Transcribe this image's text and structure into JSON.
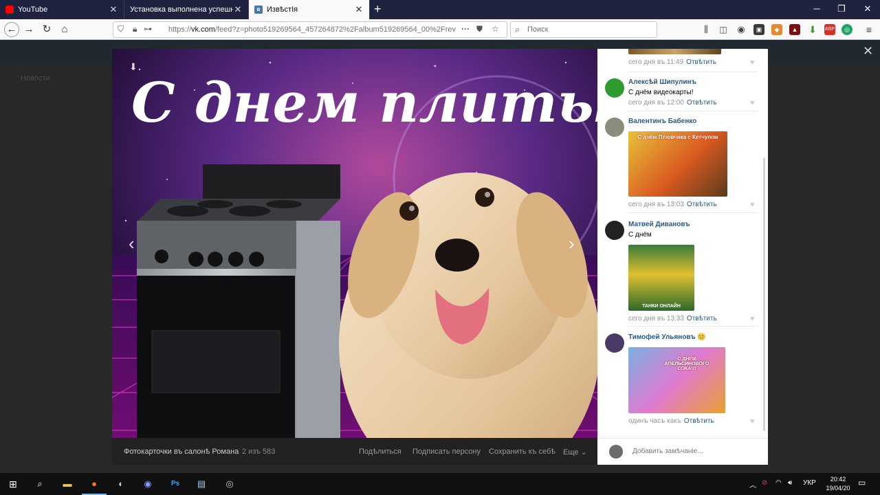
{
  "tabs": [
    {
      "label": "YouTube",
      "favicon": "youtube-icon",
      "active": false
    },
    {
      "label": "Установка выполнена успешно!",
      "favicon": "",
      "active": false
    },
    {
      "label": "ИзвѣстІя",
      "favicon": "vk-icon",
      "active": true
    }
  ],
  "url": {
    "prefix": "https://",
    "host": "vk.com",
    "path": "/feed?z=photo519269564_457264872%2Falbum519269564_00%2Frev"
  },
  "search_placeholder": "Поиск",
  "viewer": {
    "album": "Фотокарточки въ салонѣ Романа",
    "counter": "2 изъ 583",
    "share": "Подѣлиться",
    "tag": "Подписать персону",
    "save": "Сохранить къ себѣ",
    "more": "Еще",
    "photo_caption": "С днем плиты!!"
  },
  "comments": [
    {
      "name": "",
      "text": "",
      "time": "сего дня въ 11:49",
      "reply": "Отвѣтить"
    },
    {
      "name": "Алексѣй Шипулинъ",
      "text": "С днём видеокарты!",
      "time": "сего дня въ 12:00",
      "reply": "Отвѣтить"
    },
    {
      "name": "Валентинъ Бабенко",
      "text": "",
      "time": "сего дня въ 13:03",
      "reply": "Отвѣтить",
      "image_text": "С днём Плювчика с Кетчупом"
    },
    {
      "name": "Матвей Дивановъ",
      "text": "С днём",
      "time": "сего дня въ 13:33",
      "reply": "Отвѣтить",
      "image_text": "ТАНКИ ОНЛАЙН"
    },
    {
      "name": "Тимофей Ульяновъ 😊",
      "text": "",
      "time": "одинъ часъ какъ",
      "reply": "Отвѣтить",
      "image_text": "С ДНЁМ АПЕЛЬСИНОВОГО СОКА!!!"
    }
  ],
  "add_comment_placeholder": "Добавить замѣчаніе...",
  "taskbar": {
    "lang": "УКР",
    "time": "20:42",
    "date": "19/04/20"
  },
  "behind_text": "Новости"
}
